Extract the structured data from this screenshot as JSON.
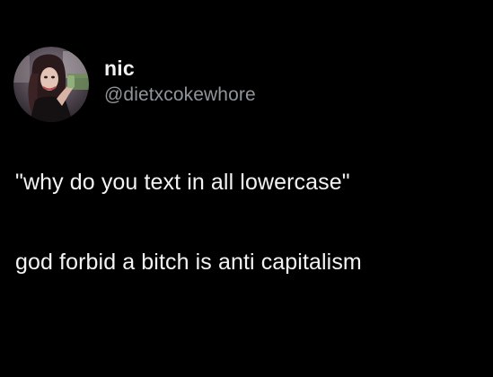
{
  "user": {
    "display_name": "nic",
    "handle": "@dietxcokewhore",
    "avatar_icon": "profile-photo"
  },
  "tweet": {
    "lines": [
      "\"why do you text in all lowercase\"",
      "god forbid a bitch is anti capitalism"
    ]
  },
  "colors": {
    "background": "#000000",
    "text": "#f3f3f3",
    "handle": "#8f959a"
  }
}
